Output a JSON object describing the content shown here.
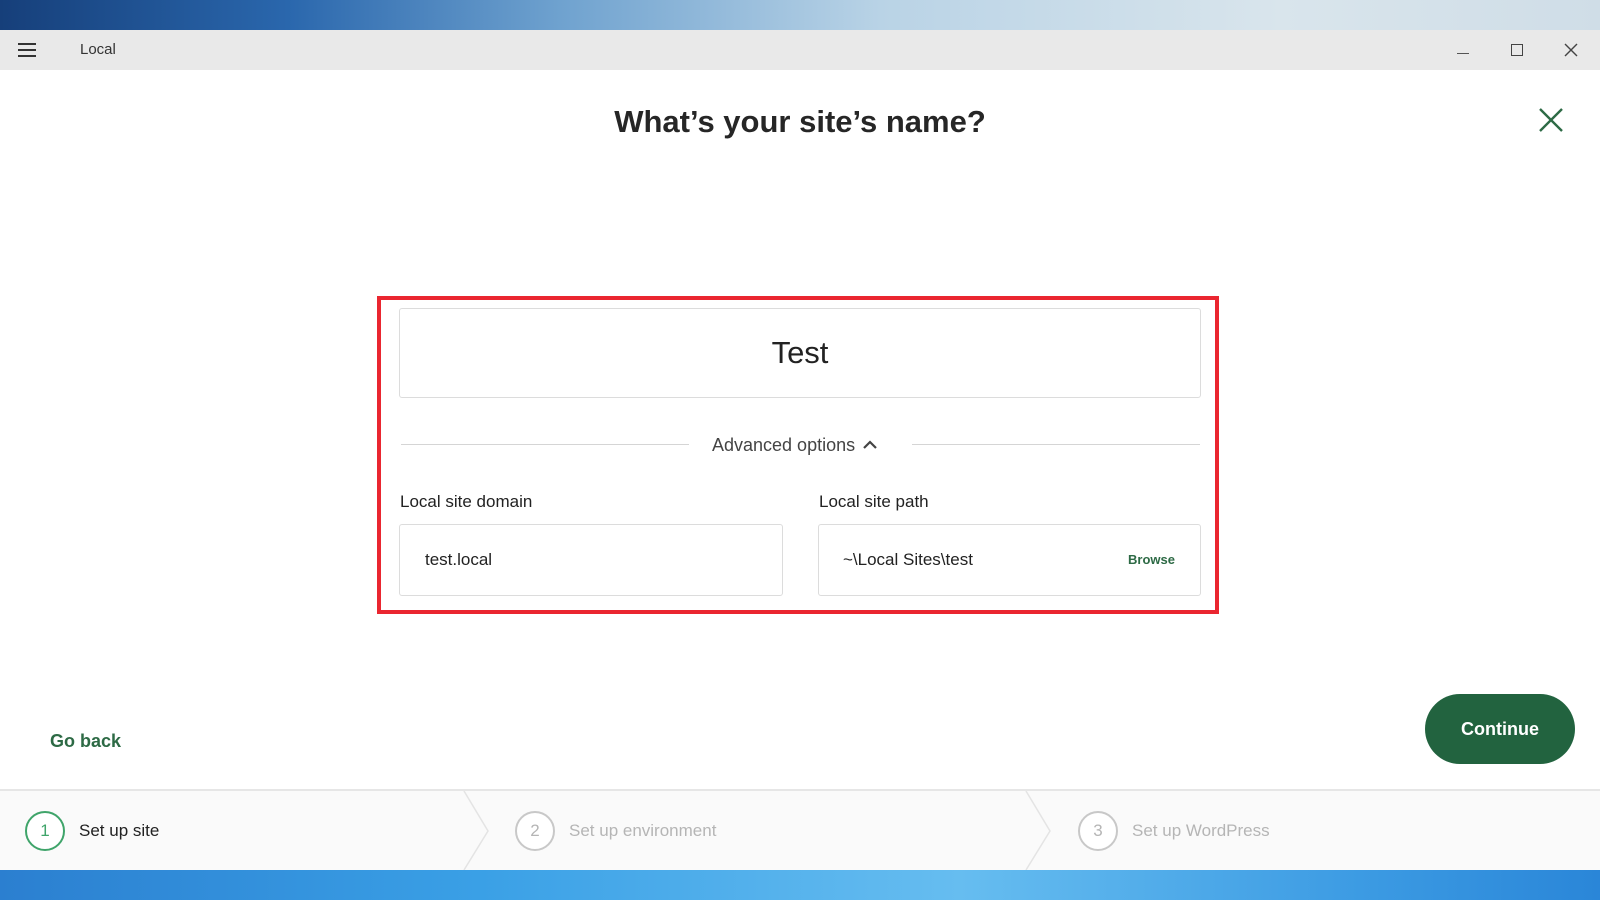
{
  "window": {
    "title": "Local",
    "controls": {
      "minimize": "minimize-icon",
      "maximize": "maximize-icon",
      "close": "close-icon"
    }
  },
  "dialog": {
    "heading": "What’s your site’s name?",
    "close_icon": "close-icon",
    "site_name": {
      "value": "Test",
      "placeholder": ""
    },
    "advanced_options": {
      "label": "Advanced options",
      "icon": "chevron-up-icon",
      "expanded": true
    },
    "domain": {
      "label": "Local site domain",
      "value": "test.local"
    },
    "path": {
      "label": "Local site path",
      "value": "~\\Local Sites\\test",
      "browse_label": "Browse"
    },
    "go_back_label": "Go back",
    "continue_label": "Continue"
  },
  "steps": [
    {
      "number": "1",
      "label": "Set up site",
      "active": true
    },
    {
      "number": "2",
      "label": "Set up environment",
      "active": false
    },
    {
      "number": "3",
      "label": "Set up WordPress",
      "active": false
    }
  ],
  "colors": {
    "accent": "#22633f",
    "link": "#2d6a45",
    "step_active": "#3fa46a",
    "highlight": "#ea2630"
  }
}
